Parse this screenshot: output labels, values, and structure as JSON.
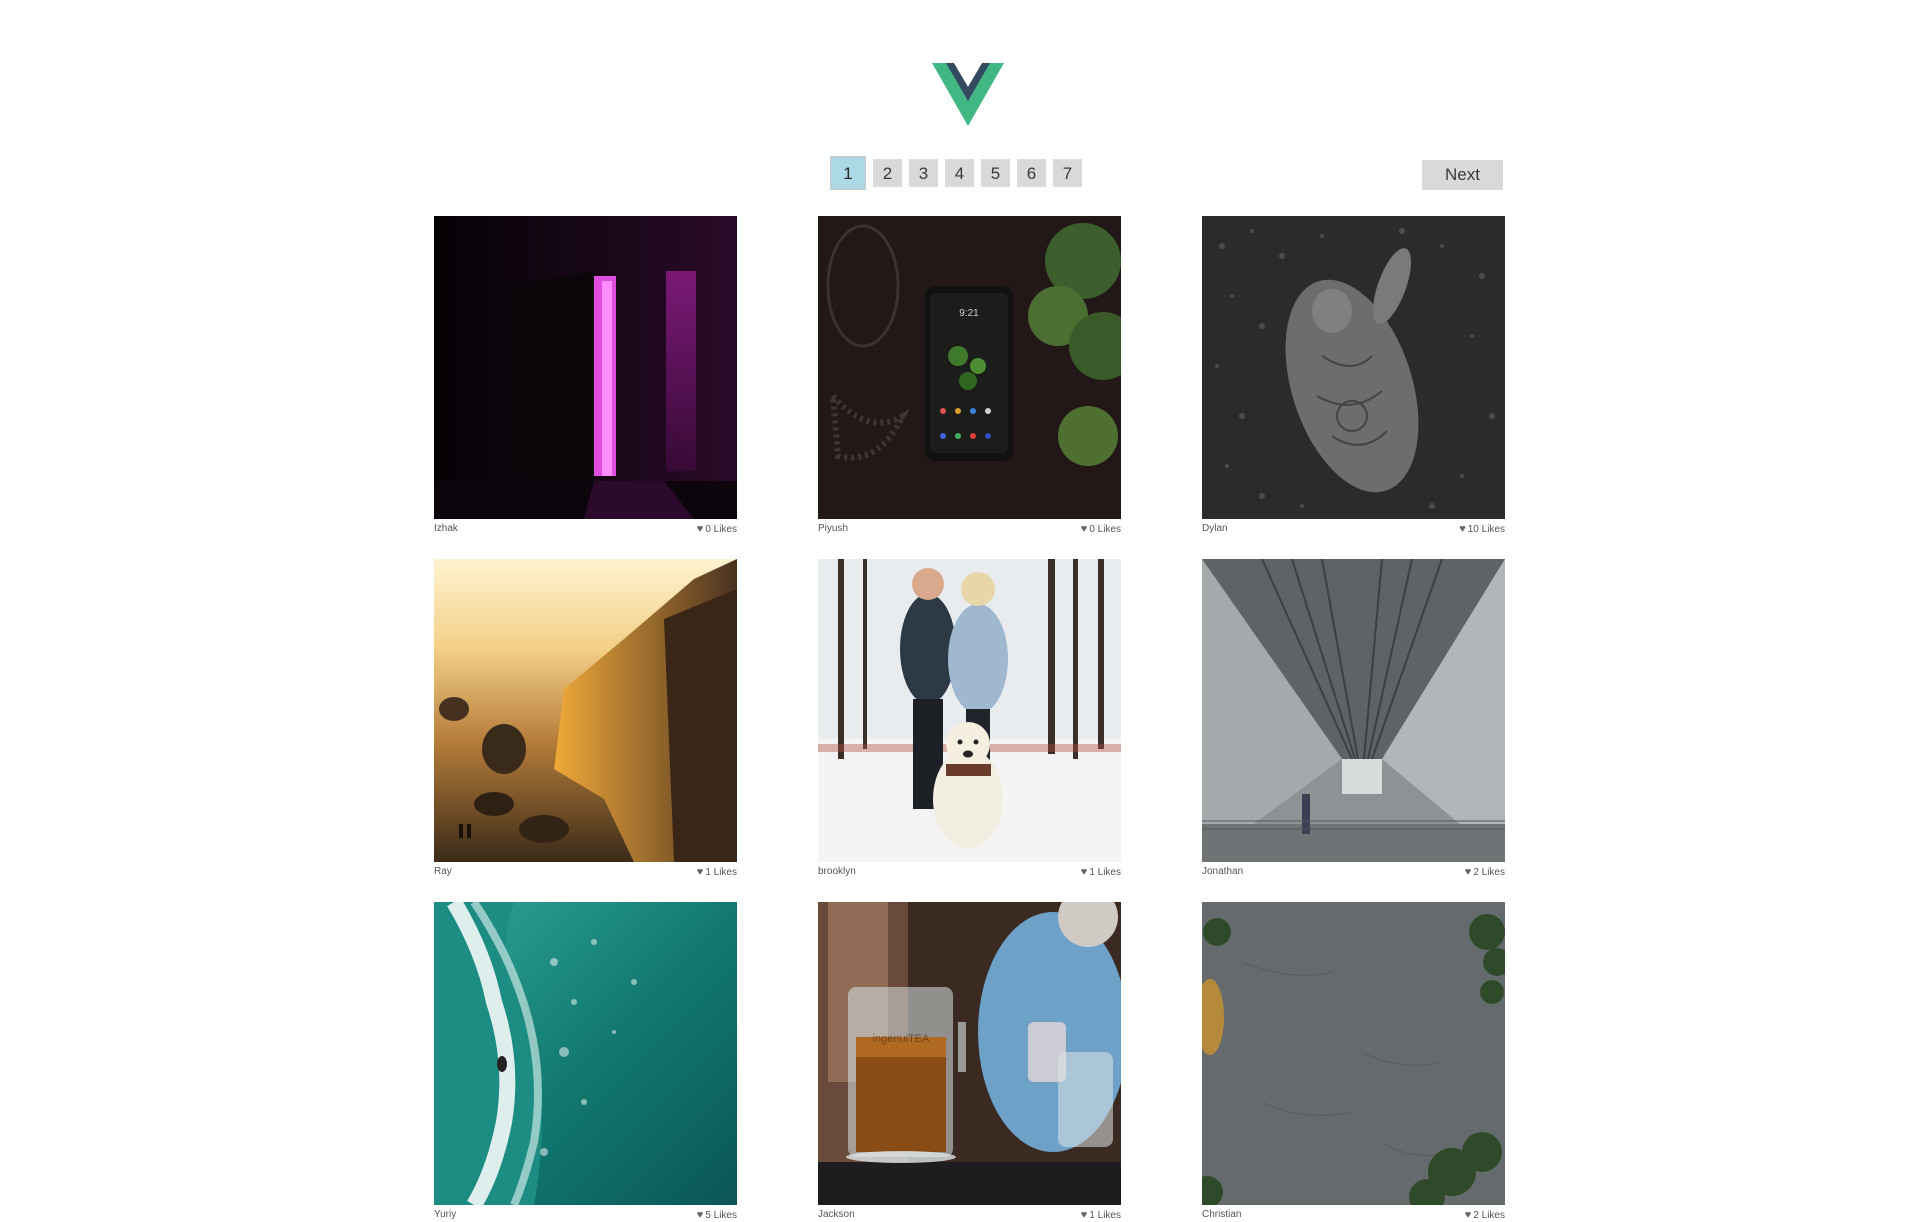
{
  "logo": {
    "name": "vue-logo",
    "outer_color": "#41b883",
    "inner_color": "#35495e"
  },
  "pagination": {
    "pages": [
      "1",
      "2",
      "3",
      "4",
      "5",
      "6",
      "7"
    ],
    "current": "1",
    "next_label": "Next",
    "active_color": "#add8e6"
  },
  "photos": [
    {
      "author": "Izhak",
      "likes": "0 Likes",
      "scene": "dark-doorway-neon"
    },
    {
      "author": "Piyush",
      "likes": "0 Likes",
      "scene": "phone-on-table"
    },
    {
      "author": "Dylan",
      "likes": "10 Likes",
      "scene": "tattooed-man-in-flowers"
    },
    {
      "author": "Ray",
      "likes": "1 Likes",
      "scene": "beach-sunset-cliffs"
    },
    {
      "author": "brooklyn",
      "likes": "1 Likes",
      "scene": "couple-with-dog-snow"
    },
    {
      "author": "Jonathan",
      "likes": "2 Likes",
      "scene": "under-bridge-concrete"
    },
    {
      "author": "Yuriy",
      "likes": "5 Likes",
      "scene": "aerial-surf-ocean"
    },
    {
      "author": "Jackson",
      "likes": "1 Likes",
      "scene": "tea-infuser-on-table"
    },
    {
      "author": "Christian",
      "likes": "2 Likes",
      "scene": "concrete-surface-pine"
    }
  ]
}
